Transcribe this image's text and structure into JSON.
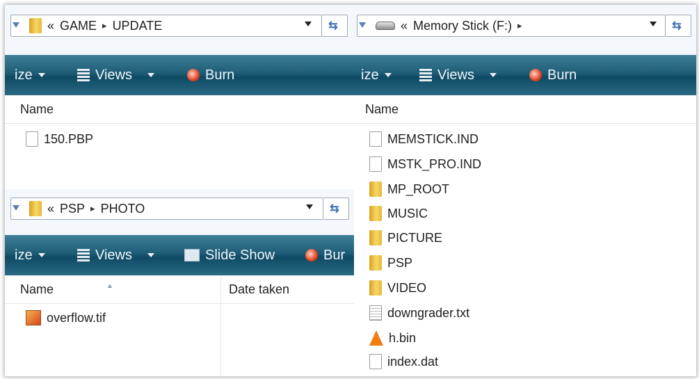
{
  "left_top_window": {
    "breadcrumb": [
      "GAME",
      "UPDATE"
    ],
    "toolbar": {
      "organize": "ize",
      "views": "Views",
      "burn": "Burn"
    },
    "column": "Name",
    "files": [
      {
        "name": "150.PBP",
        "icon": "file-icon"
      }
    ]
  },
  "left_bottom_window": {
    "breadcrumb": [
      "PSP",
      "PHOTO"
    ],
    "toolbar": {
      "organize": "ize",
      "views": "Views",
      "slideshow": "Slide Show",
      "burn": "Bur"
    },
    "columns": {
      "name": "Name",
      "date": "Date taken"
    },
    "files": [
      {
        "name": "overflow.tif",
        "icon": "image-file-icon"
      }
    ]
  },
  "right_window": {
    "breadcrumb": [
      "Memory Stick (F:)"
    ],
    "toolbar": {
      "organize": "ize",
      "views": "Views",
      "burn": "Burn"
    },
    "column": "Name",
    "files": [
      {
        "name": "MEMSTICK.IND",
        "icon": "file-icon"
      },
      {
        "name": "MSTK_PRO.IND",
        "icon": "file-icon"
      },
      {
        "name": "MP_ROOT",
        "icon": "folder-icon"
      },
      {
        "name": "MUSIC",
        "icon": "folder-icon"
      },
      {
        "name": "PICTURE",
        "icon": "folder-icon"
      },
      {
        "name": "PSP",
        "icon": "folder-icon"
      },
      {
        "name": "VIDEO",
        "icon": "folder-icon"
      },
      {
        "name": "downgrader.txt",
        "icon": "text-file-icon"
      },
      {
        "name": "h.bin",
        "icon": "vlc-cone-icon"
      },
      {
        "name": "index.dat",
        "icon": "file-icon"
      }
    ]
  },
  "symbols": {
    "chevrons": "«",
    "arrow": "▸",
    "refresh": "⇆"
  },
  "colors": {
    "toolbar": "#1f5d76",
    "folder": "#e8b735",
    "accent_blue": "#3f6fb5"
  }
}
